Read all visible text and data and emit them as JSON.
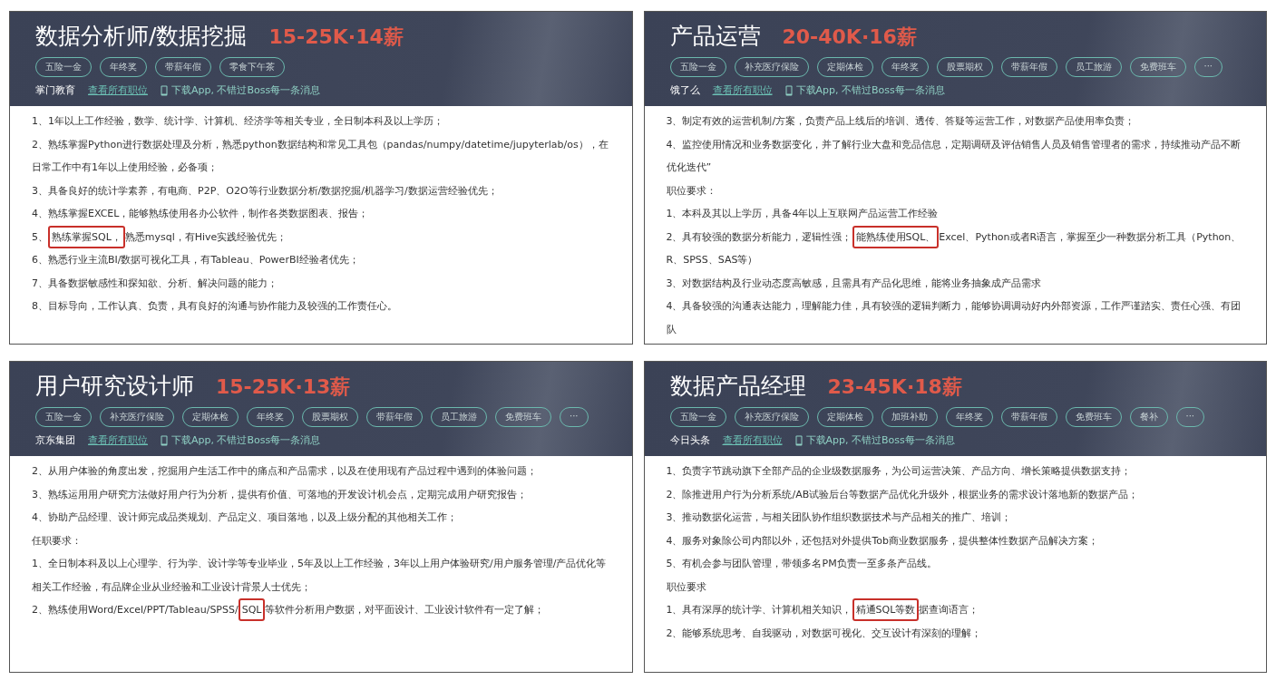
{
  "postings": [
    {
      "title": "数据分析师/数据挖掘",
      "salary": "15-25K·14薪",
      "benefits": [
        "五险一金",
        "年终奖",
        "带薪年假",
        "零食下午茶"
      ],
      "company": "掌门教育",
      "all_jobs_link": "查看所有职位",
      "app_promo": "下载App, 不错过Boss每一条消息",
      "lines": [
        {
          "parts": [
            {
              "text": "1、1年以上工作经验，数学、统计学、计算机、经济学等相关专业，全日制本科及以上学历；",
              "highlighted": false
            }
          ]
        },
        {
          "parts": [
            {
              "text": "2、熟练掌握Python进行数据处理及分析，熟悉python数据结构和常见工具包（pandas/numpy/datetime/jupyterlab/os），在日常工作中有1年以上使用经验，必备项；",
              "highlighted": false
            }
          ]
        },
        {
          "parts": [
            {
              "text": "3、具备良好的统计学素养，有电商、P2P、O2O等行业数据分析/数据挖掘/机器学习/数据运营经验优先；",
              "highlighted": false
            }
          ]
        },
        {
          "parts": [
            {
              "text": "4、熟练掌握EXCEL，能够熟练使用各办公软件，制作各类数据图表、报告；",
              "highlighted": false
            }
          ]
        },
        {
          "parts": [
            {
              "text": "5、",
              "highlighted": false
            },
            {
              "text": "熟练掌握SQL，",
              "highlighted": true
            },
            {
              "text": "熟悉mysql，有Hive实践经验优先；",
              "highlighted": false
            }
          ]
        },
        {
          "parts": [
            {
              "text": "6、熟悉行业主流BI/数据可视化工具，有Tableau、PowerBI经验者优先；",
              "highlighted": false
            }
          ]
        },
        {
          "parts": [
            {
              "text": "7、具备数据敏感性和探知欲、分析、解决问题的能力；",
              "highlighted": false
            }
          ]
        },
        {
          "parts": [
            {
              "text": "8、目标导向，工作认真、负责，具有良好的沟通与协作能力及较强的工作责任心。",
              "highlighted": false
            }
          ]
        }
      ]
    },
    {
      "title": "产品运营",
      "salary": "20-40K·16薪",
      "benefits": [
        "五险一金",
        "补充医疗保险",
        "定期体检",
        "年终奖",
        "股票期权",
        "带薪年假",
        "员工旅游",
        "免费班车",
        "···"
      ],
      "company": "饿了么",
      "all_jobs_link": "查看所有职位",
      "app_promo": "下载App, 不错过Boss每一条消息",
      "lines": [
        {
          "parts": [
            {
              "text": "3、制定有效的运营机制/方案，负责产品上线后的培训、透传、答疑等运营工作，对数据产品使用率负责；",
              "highlighted": false
            }
          ]
        },
        {
          "parts": [
            {
              "text": "4、监控使用情况和业务数据变化，并了解行业大盘和竞品信息，定期调研及评估销售人员及销售管理者的需求，持续推动产品不断优化迭代”",
              "highlighted": false
            }
          ]
        },
        {
          "parts": [
            {
              "text": "职位要求：",
              "highlighted": false
            }
          ]
        },
        {
          "parts": [
            {
              "text": "1、本科及其以上学历，具备4年以上互联网产品运营工作经验",
              "highlighted": false
            }
          ]
        },
        {
          "parts": [
            {
              "text": "2、具有较强的数据分析能力，逻辑性强；",
              "highlighted": false
            },
            {
              "text": "能熟练使用SQL、",
              "highlighted": true
            },
            {
              "text": "Excel、Python或者R语言，掌握至少一种数据分析工具（Python、R、SPSS、SAS等）",
              "highlighted": false
            }
          ]
        },
        {
          "parts": [
            {
              "text": "3、对数据结构及行业动态度高敏感，且需具有产品化思维，能将业务抽象成产品需求",
              "highlighted": false
            }
          ]
        },
        {
          "parts": [
            {
              "text": "4、具备较强的沟通表达能力，理解能力佳，具有较强的逻辑判断力，能够协调调动好内外部资源，工作严谨踏实、责任心强、有团队",
              "highlighted": false
            }
          ]
        }
      ]
    },
    {
      "title": "用户研究设计师",
      "salary": "15-25K·13薪",
      "benefits": [
        "五险一金",
        "补充医疗保险",
        "定期体检",
        "年终奖",
        "股票期权",
        "带薪年假",
        "员工旅游",
        "免费班车",
        "···"
      ],
      "company": "京东集团",
      "all_jobs_link": "查看所有职位",
      "app_promo": "下载App, 不错过Boss每一条消息",
      "lines": [
        {
          "parts": [
            {
              "text": "2、从用户体验的角度出发，挖掘用户生活工作中的痛点和产品需求，以及在使用现有产品过程中遇到的体验问题；",
              "highlighted": false
            }
          ]
        },
        {
          "parts": [
            {
              "text": "3、熟练运用用户研究方法做好用户行为分析，提供有价值、可落地的开发设计机会点，定期完成用户研究报告；",
              "highlighted": false
            }
          ]
        },
        {
          "parts": [
            {
              "text": "4、协助产品经理、设计师完成品类规划、产品定义、项目落地，以及上级分配的其他相关工作；",
              "highlighted": false
            }
          ]
        },
        {
          "parts": [
            {
              "text": "任职要求：",
              "highlighted": false
            }
          ]
        },
        {
          "parts": [
            {
              "text": "1、全日制本科及以上心理学、行为学、设计学等专业毕业，5年及以上工作经验，3年以上用户体验研究/用户服务管理/产品优化等相关工作经验，有品牌企业从业经验和工业设计背景人士优先；",
              "highlighted": false
            }
          ]
        },
        {
          "parts": [
            {
              "text": "2、熟练使用Word/Excel/PPT/Tableau/SPSS/",
              "highlighted": false
            },
            {
              "text": "SQL",
              "highlighted": true
            },
            {
              "text": "等软件分析用户数据，对平面设计、工业设计软件有一定了解；",
              "highlighted": false
            }
          ]
        }
      ]
    },
    {
      "title": "数据产品经理",
      "salary": "23-45K·18薪",
      "benefits": [
        "五险一金",
        "补充医疗保险",
        "定期体检",
        "加班补助",
        "年终奖",
        "带薪年假",
        "免费班车",
        "餐补",
        "···"
      ],
      "company": "今日头条",
      "all_jobs_link": "查看所有职位",
      "app_promo": "下载App, 不错过Boss每一条消息",
      "lines": [
        {
          "parts": [
            {
              "text": "1、负责字节跳动旗下全部产品的企业级数据服务，为公司运营决策、产品方向、增长策略提供数据支持；",
              "highlighted": false
            }
          ]
        },
        {
          "parts": [
            {
              "text": "2、除推进用户行为分析系统/AB试验后台等数据产品优化升级外，根据业务的需求设计落地新的数据产品；",
              "highlighted": false
            }
          ]
        },
        {
          "parts": [
            {
              "text": "3、推动数据化运营，与相关团队协作组织数据技术与产品相关的推广、培训；",
              "highlighted": false
            }
          ]
        },
        {
          "parts": [
            {
              "text": "4、服务对象除公司内部以外，还包括对外提供Tob商业数据服务，提供整体性数据产品解决方案；",
              "highlighted": false
            }
          ]
        },
        {
          "parts": [
            {
              "text": "5、有机会参与团队管理，带领多名PM负责一至多条产品线。",
              "highlighted": false
            }
          ]
        },
        {
          "parts": [
            {
              "text": "职位要求",
              "highlighted": false
            }
          ]
        },
        {
          "parts": [
            {
              "text": "1、具有深厚的统计学、计算机相关知识，",
              "highlighted": false
            },
            {
              "text": "精通SQL等数",
              "highlighted": true
            },
            {
              "text": "据查询语言；",
              "highlighted": false
            }
          ]
        },
        {
          "parts": [
            {
              "text": "2、能够系统思考、自我驱动，对数据可视化、交互设计有深刻的理解；",
              "highlighted": false
            }
          ]
        }
      ]
    }
  ]
}
